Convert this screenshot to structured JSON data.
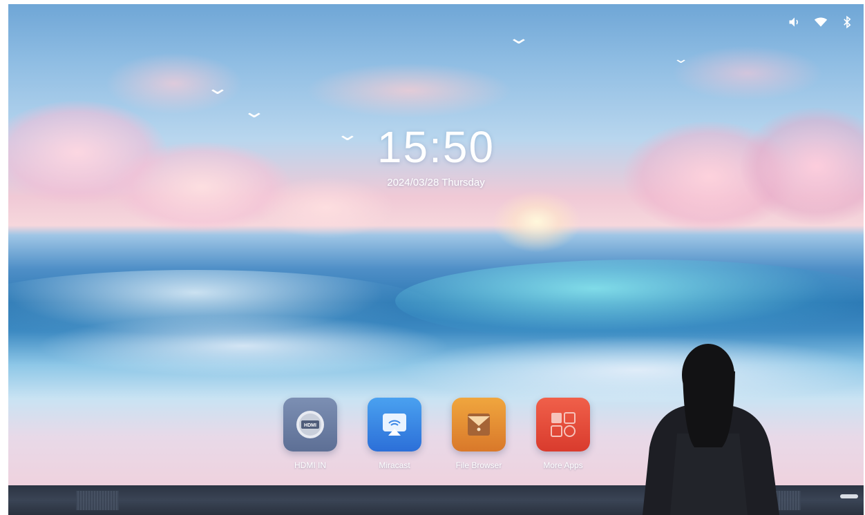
{
  "status_bar": {
    "icons": [
      "volume-icon",
      "wifi-icon",
      "bluetooth-icon"
    ]
  },
  "clock": {
    "time": "15:50",
    "date": "2024/03/28 Thursday"
  },
  "dock": {
    "apps": [
      {
        "label": "HDMI IN",
        "icon": "hdmi-icon",
        "icon_text": "HDMI",
        "color": "#6b7fa6"
      },
      {
        "label": "Miracast",
        "icon": "miracast-icon",
        "color": "#3a86e6"
      },
      {
        "label": "File Browser",
        "icon": "file-browser-icon",
        "color": "#e88e33"
      },
      {
        "label": "More Apps",
        "icon": "more-apps-icon",
        "color": "#e54b3a"
      }
    ]
  },
  "colors": {
    "sky_top": "#6fa6d6",
    "bezel": "#2c3443",
    "clock_text": "#ffffff"
  }
}
